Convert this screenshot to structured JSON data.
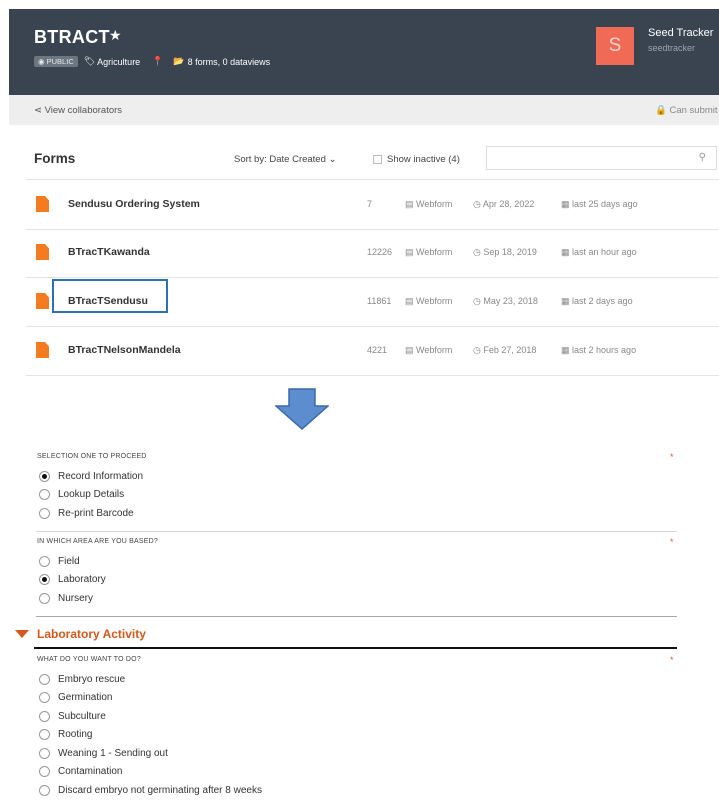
{
  "header": {
    "title": "BTRACT",
    "visibility_badge": "PUBLIC",
    "category": "Agriculture",
    "summary": "8 forms, 0 dataviews",
    "user": {
      "initial": "S",
      "name": "Seed Tracker",
      "username": "seedtracker"
    },
    "colors": {
      "header_bg": "#3a4450",
      "avatar_bg": "#f06a55"
    }
  },
  "collab_bar": {
    "view_collaborators": "View collaborators",
    "can_submit": "Can submit"
  },
  "forms_panel": {
    "title": "Forms",
    "sort_label": "Sort by: Date Created",
    "show_inactive": "Show inactive (4)",
    "search_value": "",
    "rows": [
      {
        "name": "Sendusu Ordering System",
        "count": "7",
        "type": "Webform",
        "date": "Apr 28, 2022",
        "activity": "last 25 days ago"
      },
      {
        "name": "BTracTKawanda",
        "count": "12226",
        "type": "Webform",
        "date": "Sep 18, 2019",
        "activity": "last an hour ago"
      },
      {
        "name": "BTracTSendusu",
        "count": "11861",
        "type": "Webform",
        "date": "May 23, 2018",
        "activity": "last 2 days ago"
      },
      {
        "name": "BTracTNelsonMandela",
        "count": "4221",
        "type": "Webform",
        "date": "Feb 27, 2018",
        "activity": "last 2 hours ago"
      }
    ]
  },
  "form": {
    "q1": {
      "label": "SELECTION ONE TO PROCEED",
      "required": "*",
      "options": [
        "Record Information",
        "Lookup Details",
        "Re-print Barcode"
      ],
      "selected": "Record Information"
    },
    "q2": {
      "label": "IN WHICH AREA ARE YOU BASED?",
      "required": "*",
      "options": [
        "Field",
        "Laboratory",
        "Nursery"
      ],
      "selected": "Laboratory"
    },
    "section_title": "Laboratory Activity",
    "q3": {
      "label": "WHAT DO YOU WANT TO DO?",
      "required": "*",
      "options": [
        "Embryo rescue",
        "Germination",
        "Subculture",
        "Rooting",
        "Weaning 1 - Sending out",
        "Contamination",
        "Discard embryo not germinating after 8 weeks"
      ]
    }
  }
}
